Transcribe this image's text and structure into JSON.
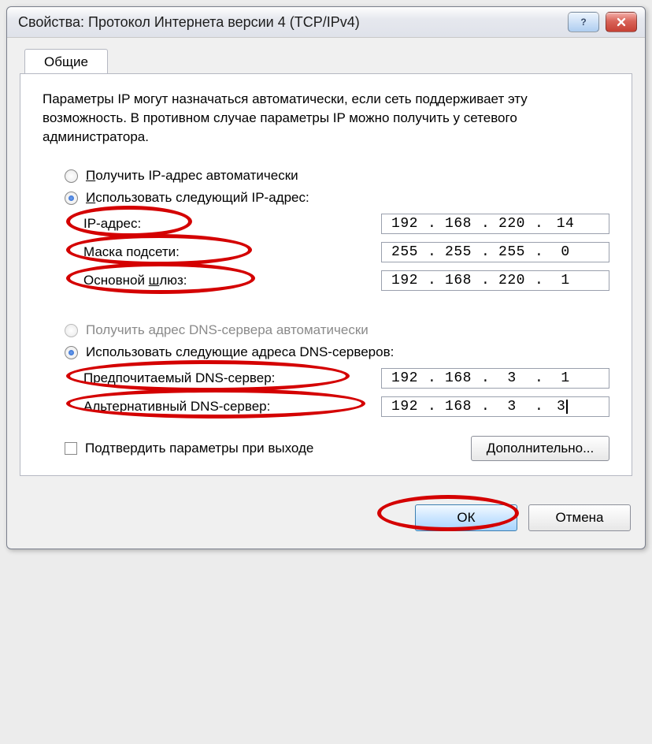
{
  "window": {
    "title": "Свойства: Протокол Интернета версии 4 (TCP/IPv4)"
  },
  "tab": {
    "label": "Общие"
  },
  "description": "Параметры IP могут назначаться автоматически, если сеть поддерживает эту возможность. В противном случае параметры IP можно получить у сетевого администратора.",
  "ip": {
    "auto_label": "Получить IP-адрес автоматически",
    "auto_u": "П",
    "manual_label": "Использовать следующий IP-адрес:",
    "manual_u": "И",
    "fields": {
      "address_label": "IP-адрес:",
      "address": [
        "192",
        "168",
        "220",
        "14"
      ],
      "mask_label": "Маска подсети:",
      "mask": [
        "255",
        "255",
        "255",
        "0"
      ],
      "gateway_label": "Основной шлюз:",
      "gateway": [
        "192",
        "168",
        "220",
        "1"
      ]
    }
  },
  "dns": {
    "auto_label": "Получить адрес DNS-сервера автоматически",
    "manual_label": "Использовать следующие адреса DNS-серверов:",
    "fields": {
      "preferred_label": "Предпочитаемый DNS-сервер:",
      "preferred": [
        "192",
        "168",
        "3",
        "1"
      ],
      "alternate_label": "Альтернативный DNS-сервер:",
      "alternate": [
        "192",
        "168",
        "3",
        "3"
      ]
    }
  },
  "confirm": {
    "label": "Подтвердить параметры при выходе"
  },
  "buttons": {
    "advanced": "Дополнительно...",
    "ok": "ОК",
    "cancel": "Отмена"
  },
  "colors": {
    "annotation": "#d40000"
  }
}
